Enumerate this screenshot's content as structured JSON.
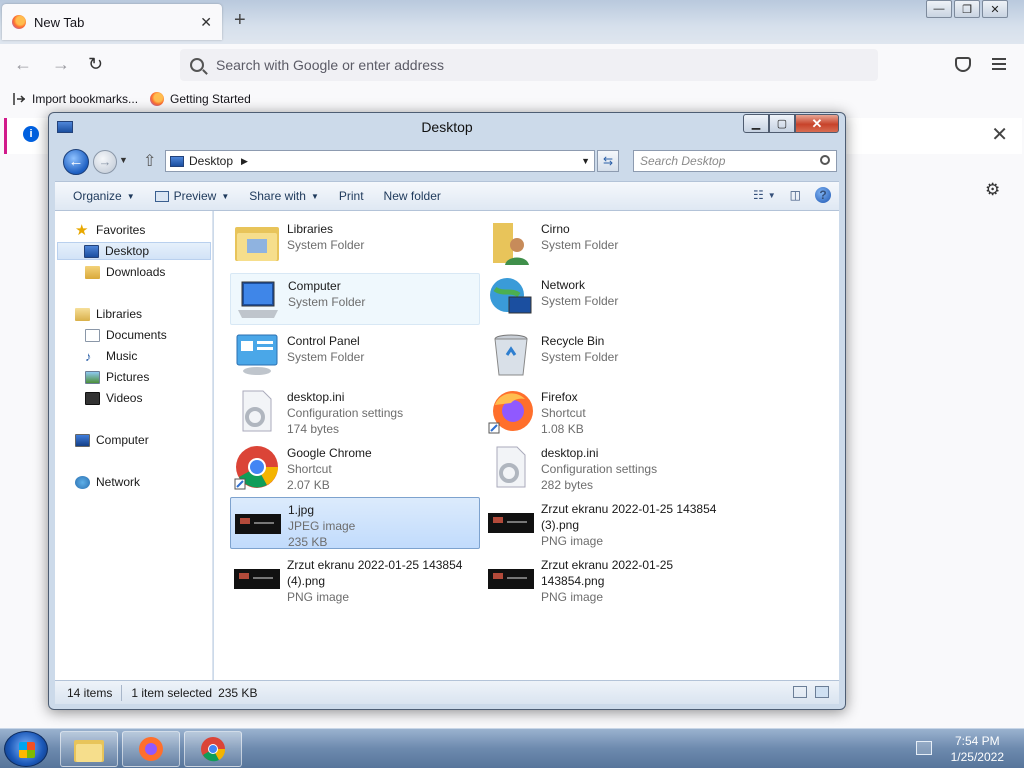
{
  "browser": {
    "tab_title": "New Tab",
    "tab_close": "✕",
    "new_tab": "+",
    "window_controls": [
      "—",
      "❐",
      "✕"
    ],
    "back": "←",
    "forward": "→",
    "reload": "↻",
    "url_placeholder": "Search with Google or enter address",
    "bookmarks": [
      "Import bookmarks...",
      "Getting Started"
    ],
    "notice_close": "✕",
    "notice_info": "i",
    "gear": "⚙"
  },
  "explorer": {
    "title": "Desktop",
    "window_controls": {
      "minimize": "▁",
      "maximize": "▢",
      "close": "✕"
    },
    "back": "←",
    "forward": "→",
    "history": "▼",
    "up": "⇧",
    "address": "Desktop",
    "address_arrow": "▶",
    "address_dropdown": "▼",
    "refresh": "⇆",
    "search_placeholder": "Search Desktop",
    "toolbar": {
      "organize": "Organize",
      "preview": "Preview",
      "share_with": "Share with",
      "print": "Print",
      "new_folder": "New folder",
      "caret": "▼",
      "help": "?",
      "view_icon": "☷",
      "pane_icon": "◫"
    },
    "nav": {
      "favorites": "Favorites",
      "desktop": "Desktop",
      "downloads": "Downloads",
      "libraries": "Libraries",
      "documents": "Documents",
      "music": "Music",
      "pictures": "Pictures",
      "videos": "Videos",
      "computer": "Computer",
      "network": "Network"
    },
    "items": [
      {
        "name": "Libraries",
        "l1": "System Folder",
        "l2": ""
      },
      {
        "name": "Cirno",
        "l1": "System Folder",
        "l2": ""
      },
      {
        "name": "Computer",
        "l1": "System Folder",
        "l2": ""
      },
      {
        "name": "Network",
        "l1": "System Folder",
        "l2": ""
      },
      {
        "name": "Control Panel",
        "l1": "System Folder",
        "l2": ""
      },
      {
        "name": "Recycle Bin",
        "l1": "System Folder",
        "l2": ""
      },
      {
        "name": "desktop.ini",
        "l1": "Configuration settings",
        "l2": "174 bytes"
      },
      {
        "name": "Firefox",
        "l1": "Shortcut",
        "l2": "1.08 KB"
      },
      {
        "name": "Google Chrome",
        "l1": "Shortcut",
        "l2": "2.07 KB"
      },
      {
        "name": "desktop.ini",
        "l1": "Configuration settings",
        "l2": "282 bytes"
      },
      {
        "name": "1.jpg",
        "l1": "JPEG image",
        "l2": "235 KB"
      },
      {
        "name": "Zrzut ekranu 2022-01-25 143854",
        "l1": "(3).png",
        "l2": "PNG image"
      },
      {
        "name": "Zrzut ekranu 2022-01-25 143854",
        "l1": "(4).png",
        "l2": "PNG image"
      },
      {
        "name": "Zrzut ekranu 2022-01-25",
        "l1": "143854.png",
        "l2": "PNG image"
      }
    ],
    "status": {
      "count": "14 items",
      "selected": "1 item selected",
      "size": "235 KB"
    }
  },
  "taskbar": {
    "time": "7:54 PM",
    "date": "1/25/2022"
  }
}
